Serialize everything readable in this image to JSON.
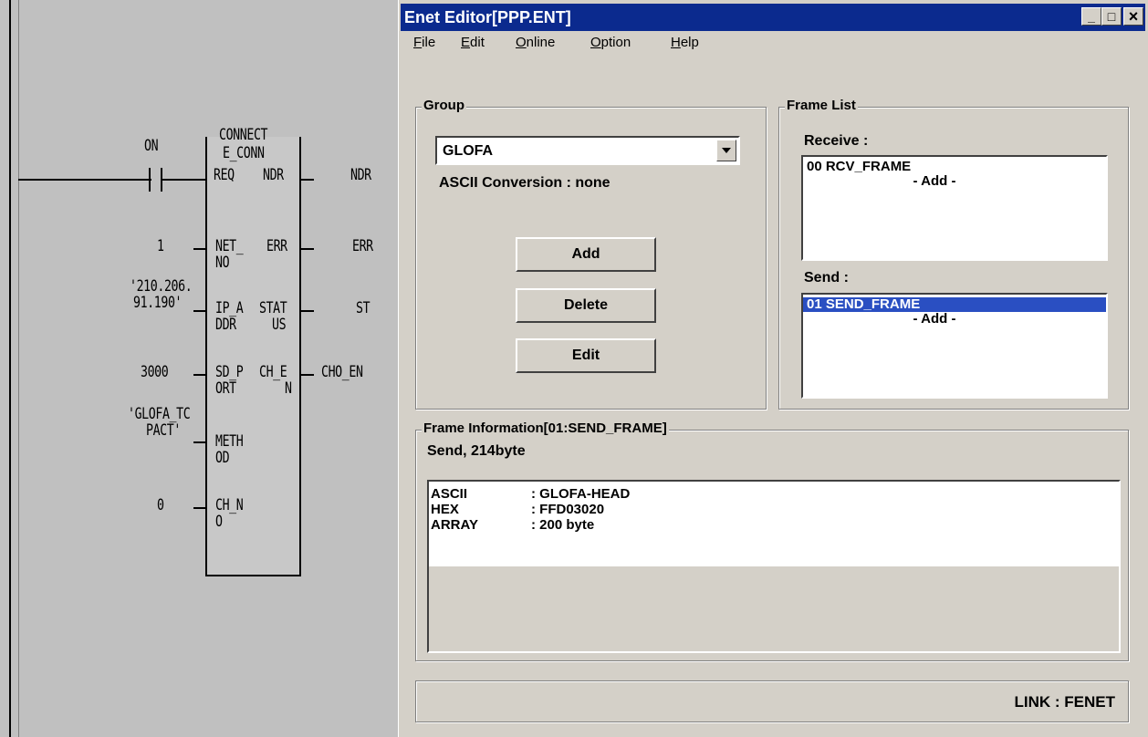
{
  "ladder": {
    "contact_label": "ON",
    "block_name_line1": "CONNECT",
    "block_name_line2": "E_CONN",
    "inputs": [
      {
        "value": "1",
        "pin_line1": "NET_",
        "pin_line2": "NO"
      },
      {
        "value_line1": "'210.206.",
        "value_line2": "91.190'",
        "pin_line1": "IP_A",
        "pin_line2": "DDR"
      },
      {
        "value": "3000",
        "pin_line1": "SD_P",
        "pin_line2": "ORT"
      },
      {
        "value_line1": "'GLOFA_TC",
        "value_line2": "PACT'",
        "pin_line1": "METH",
        "pin_line2": "OD"
      },
      {
        "value": "0",
        "pin_line1": "CH_N",
        "pin_line2": "O"
      }
    ],
    "req_pin": "REQ",
    "outputs": [
      {
        "pin_line1": "NDR",
        "pin_line2": "",
        "var": "NDR"
      },
      {
        "pin_line1": "ERR",
        "pin_line2": "",
        "var": "ERR"
      },
      {
        "pin_line1": "STAT",
        "pin_line2": "US",
        "var": "ST"
      },
      {
        "pin_line1": "CH_E",
        "pin_line2": "N",
        "var": "CHO_EN"
      }
    ]
  },
  "window": {
    "title": "Enet Editor[PPP.ENT]",
    "buttons": {
      "minimize": "_",
      "maximize": "□",
      "close": "×"
    }
  },
  "menu": [
    "File",
    "Edit",
    "Online",
    "Option",
    "Help"
  ],
  "group": {
    "title": "Group",
    "selected": "GLOFA",
    "conversion": "ASCII Conversion : none",
    "buttons": [
      "Add",
      "Delete",
      "Edit"
    ]
  },
  "frame_list": {
    "title": "Frame List",
    "receive_label": "Receive :",
    "receive_items": [
      "00 RCV_FRAME",
      "- Add -"
    ],
    "send_label": "Send :",
    "send_items": [
      "01 SEND_FRAME",
      "- Add -"
    ]
  },
  "frame_info": {
    "title": "Frame Information[01:SEND_FRAME]",
    "summary": "Send, 214byte",
    "lines": [
      {
        "key": "ASCII",
        "value": ": GLOFA-HEAD"
      },
      {
        "key": "HEX",
        "value": ": FFD03020"
      },
      {
        "key": "ARRAY",
        "value": ": 200 byte"
      }
    ]
  },
  "status": {
    "link": "LINK : FENET"
  }
}
